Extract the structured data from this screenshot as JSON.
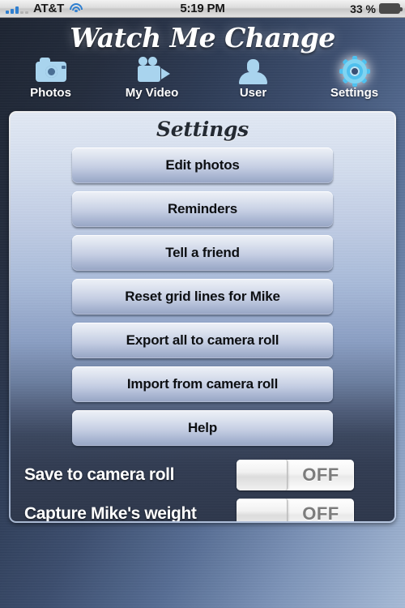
{
  "status_bar": {
    "carrier": "AT&T",
    "time": "5:19 PM",
    "battery_percent": "33 %",
    "battery_level": 33,
    "signal_bars_filled": 3,
    "signal_bars_total": 5,
    "wifi_icon": "wifi-icon"
  },
  "header": {
    "app_title": "Watch Me Change"
  },
  "tabs": [
    {
      "label": "Photos",
      "icon": "camera-icon",
      "active": false
    },
    {
      "label": "My Video",
      "icon": "video-camera-icon",
      "active": false
    },
    {
      "label": "User",
      "icon": "person-icon",
      "active": false
    },
    {
      "label": "Settings",
      "icon": "gear-icon",
      "active": true
    }
  ],
  "panel": {
    "title": "Settings",
    "buttons": [
      {
        "label": "Edit photos"
      },
      {
        "label": "Reminders"
      },
      {
        "label": "Tell a friend"
      },
      {
        "label": "Reset grid lines for Mike"
      },
      {
        "label": "Export all to camera roll"
      },
      {
        "label": "Import from camera roll"
      },
      {
        "label": "Help"
      }
    ],
    "switches": [
      {
        "label": "Save to camera roll",
        "state": "OFF"
      },
      {
        "label": "Capture Mike's weight",
        "state": "OFF"
      }
    ]
  },
  "colors": {
    "accent_blue": "#4fc0ee",
    "icon_blue": "#a9d4ee",
    "battery_green": "#6cc824",
    "signal_blue": "#2f7fd0",
    "panel_dark": "#2d374b",
    "button_text": "#0d0f12"
  }
}
